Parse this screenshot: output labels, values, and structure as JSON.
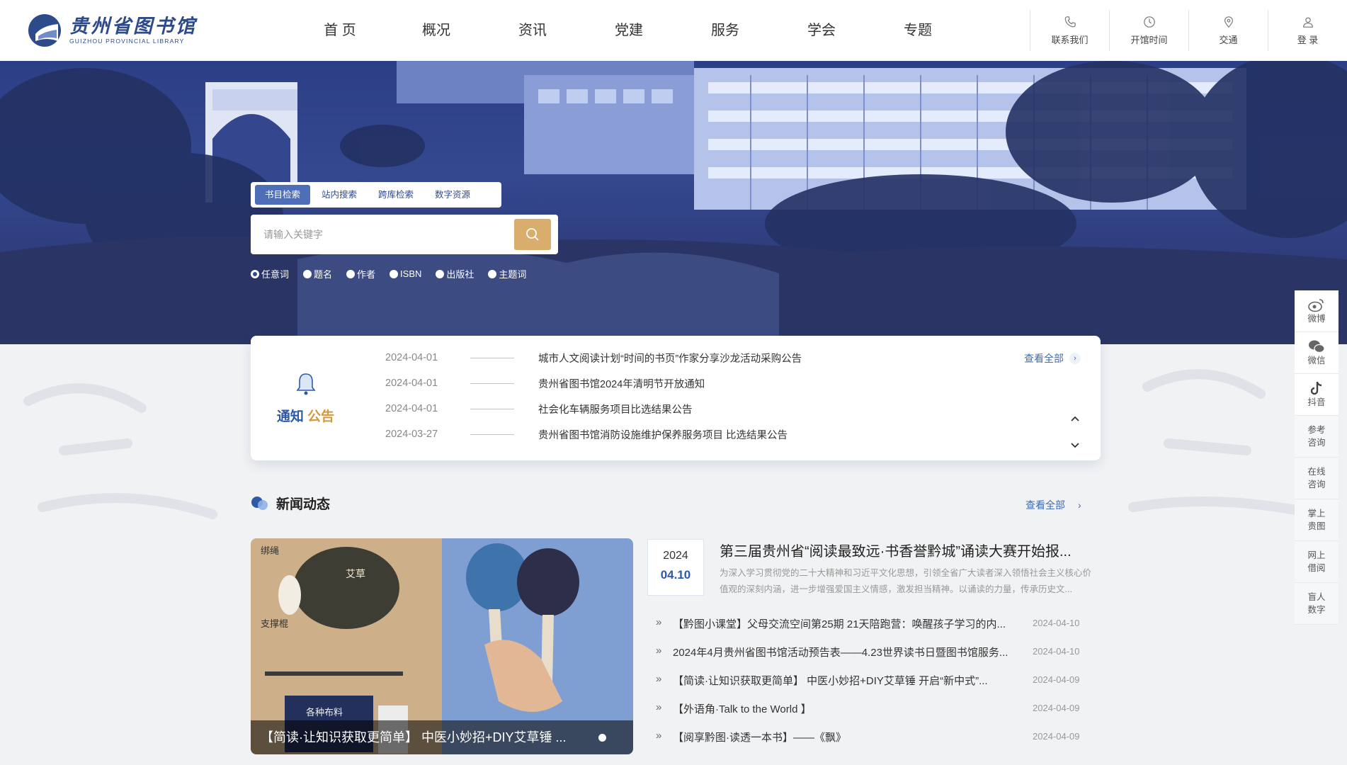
{
  "logo": {
    "cn": "贵州省图书馆",
    "en": "GUIZHOU PROVINCIAL LIBRARY"
  },
  "nav": [
    "首 页",
    "概况",
    "资讯",
    "党建",
    "服务",
    "学会",
    "专题"
  ],
  "quick_links": [
    "联系我们",
    "开馆时间",
    "交通",
    "登 录"
  ],
  "search": {
    "tabs": [
      "书目检索",
      "站内搜索",
      "跨库检索",
      "数字资源"
    ],
    "placeholder": "请输入关键字",
    "options": [
      "任意词",
      "题名",
      "作者",
      "ISBN",
      "出版社",
      "主题词"
    ]
  },
  "notice": {
    "title_a": "通知",
    "title_b": "公告",
    "view_all": "查看全部",
    "items": [
      {
        "date": "2024-04-01",
        "text": "城市人文阅读计划“时间的书页”作家分享沙龙活动采购公告"
      },
      {
        "date": "2024-04-01",
        "text": "贵州省图书馆2024年清明节开放通知"
      },
      {
        "date": "2024-04-01",
        "text": "社会化车辆服务项目比选结果公告"
      },
      {
        "date": "2024-03-27",
        "text": "贵州省图书馆消防设施维护保养服务项目 比选结果公告"
      }
    ]
  },
  "news": {
    "title": "新闻动态",
    "view_all": "查看全部",
    "caption": "【简读·让知识获取更简单】 中医小妙招+DIY艾草锤 ...",
    "img_labels": [
      "绑绳",
      "艾草",
      "支撑棍",
      "各种布料"
    ],
    "featured": {
      "year": "2024",
      "date": "04.10",
      "title": "第三届贵州省“阅读最致远·书香誉黔城”诵读大赛开始报...",
      "desc": "为深入学习贯彻党的二十大精神和习近平文化思想，引领全省广大读者深入领悟社会主义核心价值观的深刻内涵，进一步增强爱国主义情感，激发担当精神。以诵读的力量，传承历史文..."
    },
    "items": [
      {
        "text": "【黔图小课堂】父母交流空间第25期 21天陪跑营：唤醒孩子学习的内...",
        "date": "2024-04-10"
      },
      {
        "text": "2024年4月贵州省图书馆活动预告表——4.23世界读书日暨图书馆服务...",
        "date": "2024-04-10"
      },
      {
        "text": "【简读·让知识获取更简单】 中医小妙招+DIY艾草锤 开启“新中式”...",
        "date": "2024-04-09"
      },
      {
        "text": "【外语角·Talk to the World 】",
        "date": "2024-04-09"
      },
      {
        "text": "【阅享黔图·读透一本书】——《飘》",
        "date": "2024-04-09"
      }
    ]
  },
  "float_menu": [
    "微博",
    "微信",
    "抖音",
    "参考咨询",
    "在线咨询",
    "掌上贵图",
    "网上借阅",
    "盲人数字"
  ],
  "colors": {
    "brand": "#2d4a8a",
    "accent_gold": "#d9ad6c",
    "link_blue": "#3e6cb5"
  }
}
